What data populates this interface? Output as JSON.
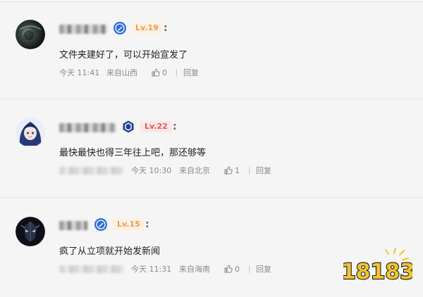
{
  "comments": [
    {
      "level": "Lv.19",
      "level_color": "#e8a050",
      "text": "文件夹建好了，可以开始宣发了",
      "time": "今天 11:41",
      "location": "来自山西",
      "likes": "0",
      "reply_label": "回复",
      "avatar_icon": "dark-sphere-avatar",
      "badge_icon": "verified-pen-icon"
    },
    {
      "level": "Lv.22",
      "level_color": "#e05a5a",
      "text": "最快最快也得三年往上吧，那还够等",
      "time": "今天 10:30",
      "location": "来自北京",
      "likes": "1",
      "reply_label": "回复",
      "avatar_icon": "anime-girl-avatar",
      "badge_icon": "hexagon-badge-icon"
    },
    {
      "level": "Lv.15",
      "level_color": "#e8a050",
      "text": "疯了从立项就开始发新闻",
      "time": "今天 11:31",
      "location": "来自海南",
      "likes": "0",
      "reply_label": "回复",
      "avatar_icon": "dark-armor-avatar",
      "badge_icon": "verified-pen-icon"
    }
  ],
  "logo": {
    "text": "18183",
    "colors": [
      "#f2c230",
      "#1a1a1a"
    ]
  }
}
